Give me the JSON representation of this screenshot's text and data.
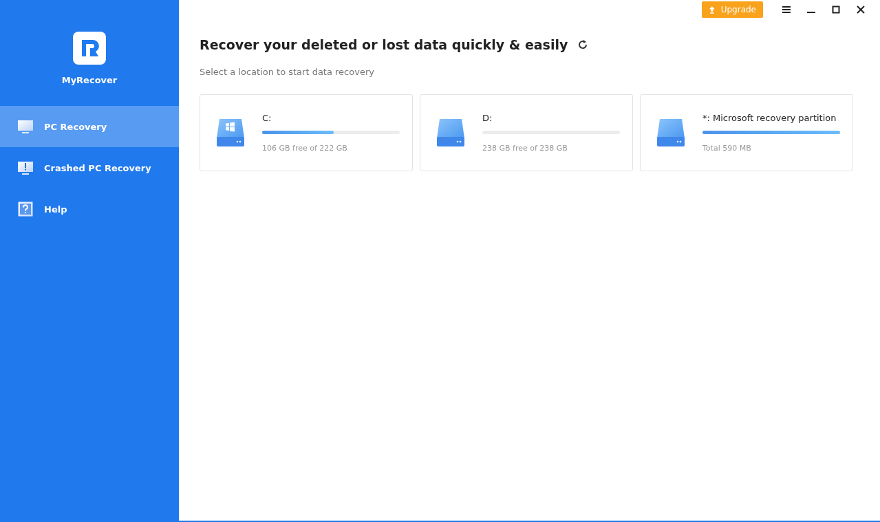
{
  "app": {
    "name": "MyRecover"
  },
  "sidebar": {
    "items": [
      {
        "label": "PC Recovery",
        "kind": "monitor",
        "selected": true
      },
      {
        "label": "Crashed PC Recovery",
        "kind": "alert",
        "selected": false
      },
      {
        "label": "Help",
        "kind": "help",
        "selected": false
      }
    ]
  },
  "toolbar": {
    "upgrade": "Upgrade"
  },
  "main": {
    "title": "Recover your deleted or lost data quickly & easily",
    "subtitle": "Select a location to start data recovery",
    "drives": [
      {
        "name": "C:",
        "kind": "system",
        "level": 0.52,
        "info": "106 GB free of 222 GB"
      },
      {
        "name": "D:",
        "kind": "data",
        "level": 0,
        "info": "238 GB free of 238 GB"
      },
      {
        "name": "*: Microsoft recovery partition",
        "kind": "data",
        "level": 1,
        "info": "Total 590 MB"
      }
    ]
  }
}
